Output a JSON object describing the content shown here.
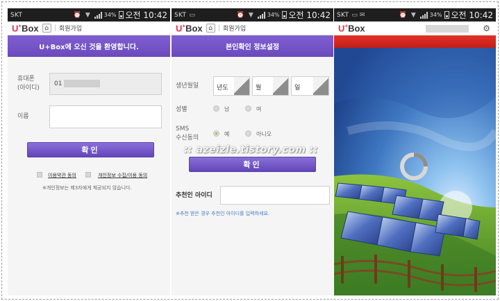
{
  "status_bar": {
    "carrier": "SKT",
    "battery": "34%",
    "time": "오전 10:42"
  },
  "brand": {
    "name": "Box",
    "prefix": "U",
    "plus": "+"
  },
  "screen1": {
    "crumb": "회원가입",
    "header": "U+Box에 오신 것을 환영합니다.",
    "phone_label_1": "휴대폰",
    "phone_label_2": "(아이디)",
    "phone_value": "01",
    "name_label": "이름",
    "confirm_button": "확인",
    "terms_link": "이용약관 동의",
    "privacy_link": "개인정보 수집/이용 동의",
    "notice": "※개인정보는 제3자에게 제공되지 않습니다."
  },
  "screen2": {
    "crumb": "회원가입",
    "header": "본인확인 정보설정",
    "birth_label": "생년월일",
    "year": "년도",
    "month": "월",
    "day": "일",
    "gender_label": "성별",
    "male": "남",
    "female": "여",
    "sms_label_1": "SMS",
    "sms_label_2": "수신동의",
    "sms_yes": "예",
    "sms_no": "아니오",
    "confirm_button": "확인",
    "recommender_label": "추천인 아이디",
    "recommender_note": "※추천 받은 경우 추천인 아이디를 입력하세요."
  },
  "watermark": ":: azeizle.tistory.com ::",
  "icons": {
    "home": "home-icon",
    "settings": "gear-icon",
    "loading": "spinner-icon"
  },
  "colors": {
    "accent": "#6a4abd",
    "brand_red": "#e2324c",
    "red_strip": "#d42820",
    "sky": "#4f86c8"
  }
}
